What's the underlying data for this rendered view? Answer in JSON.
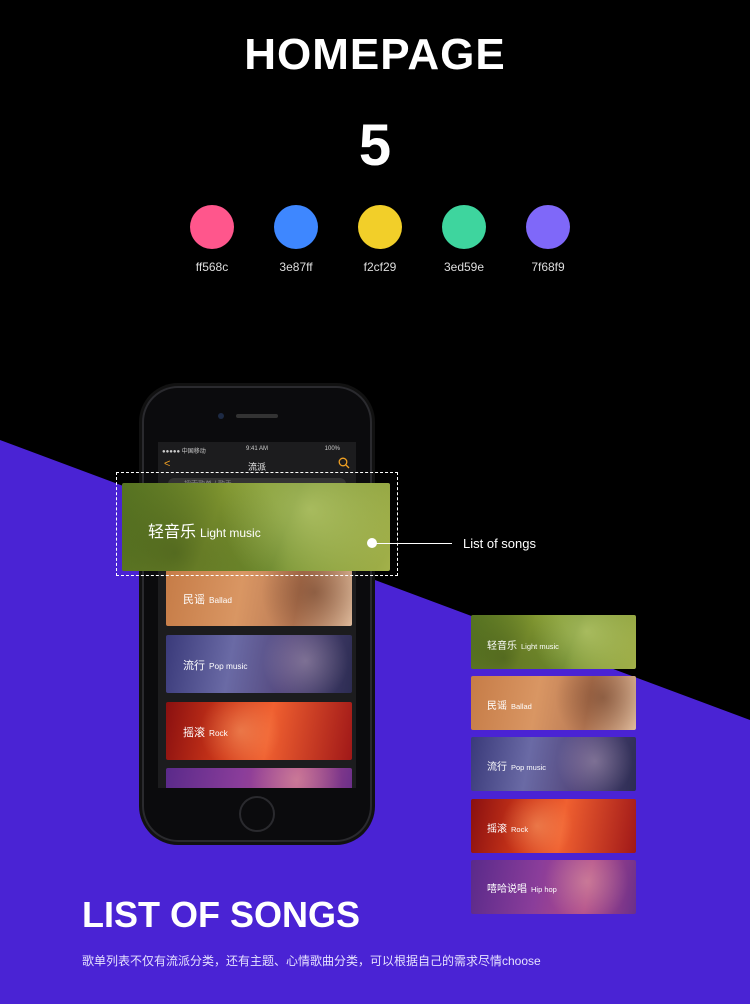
{
  "header": {
    "title": "HOMEPAGE",
    "count": "5"
  },
  "palette": [
    {
      "hex": "#ff568c",
      "label": "ff568c"
    },
    {
      "hex": "#3e87ff",
      "label": "3e87ff"
    },
    {
      "hex": "#f2cf29",
      "label": "f2cf29"
    },
    {
      "hex": "#3ed59e",
      "label": "3ed59e"
    },
    {
      "hex": "#7f68f9",
      "label": "7f68f9"
    }
  ],
  "phone": {
    "status": {
      "carrier": "●●●●● 中国移动",
      "time": "9:41 AM",
      "battery": "100%"
    },
    "nav_title": "流派",
    "search_placeholder": "搜索歌单 / 歌手"
  },
  "genres": [
    {
      "zh": "轻音乐",
      "en": "Light music"
    },
    {
      "zh": "民谣",
      "en": "Ballad"
    },
    {
      "zh": "流行",
      "en": "Pop music"
    },
    {
      "zh": "摇滚",
      "en": "Rock"
    },
    {
      "zh": "嘻哈说唱",
      "en": "Hip hop"
    }
  ],
  "callout": "List of songs",
  "section": {
    "title": "LIST OF SONGS",
    "description": "歌单列表不仅有流派分类，还有主题、心情歌曲分类，可以根据自己的需求尽情choose"
  },
  "colors": {
    "background": "#000000",
    "diagonal": "#4a23d4",
    "accent": "#f2a122"
  }
}
